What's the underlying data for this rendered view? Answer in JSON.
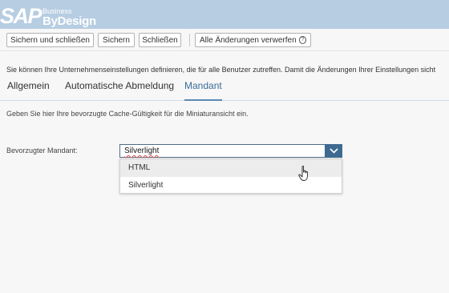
{
  "brand": {
    "sap": "SAP",
    "business": "Business",
    "bydesign": "ByDesign"
  },
  "toolbar": {
    "save_close": "Sichern und schließen",
    "save": "Sichern",
    "close": "Schließen",
    "discard_all": "Alle Änderungen verwerfen",
    "help_glyph": "?"
  },
  "info_text": "Sie können Ihre Unternehmenseinstellungen definieren, die für alle Benutzer zutreffen. Damit die Änderungen Ihrer Einstellungen sicht",
  "tabs": [
    {
      "label": "Allgemein",
      "active": false
    },
    {
      "label": "Automatische Abmeldung",
      "active": false
    },
    {
      "label": "Mandant",
      "active": true
    }
  ],
  "description": "Geben Sie hier Ihre bevorzugte Cache-Gültigkeit für die Miniaturansicht ein.",
  "preferred_client": {
    "label": "Bevorzugter Mandant:",
    "value": "Silverlight",
    "options": [
      "HTML",
      "Silverlight"
    ],
    "hovered_option": "HTML"
  },
  "colors": {
    "header_bg": "#b6cde2",
    "accent": "#3e6a90",
    "active_tab": "#3a6d99"
  }
}
